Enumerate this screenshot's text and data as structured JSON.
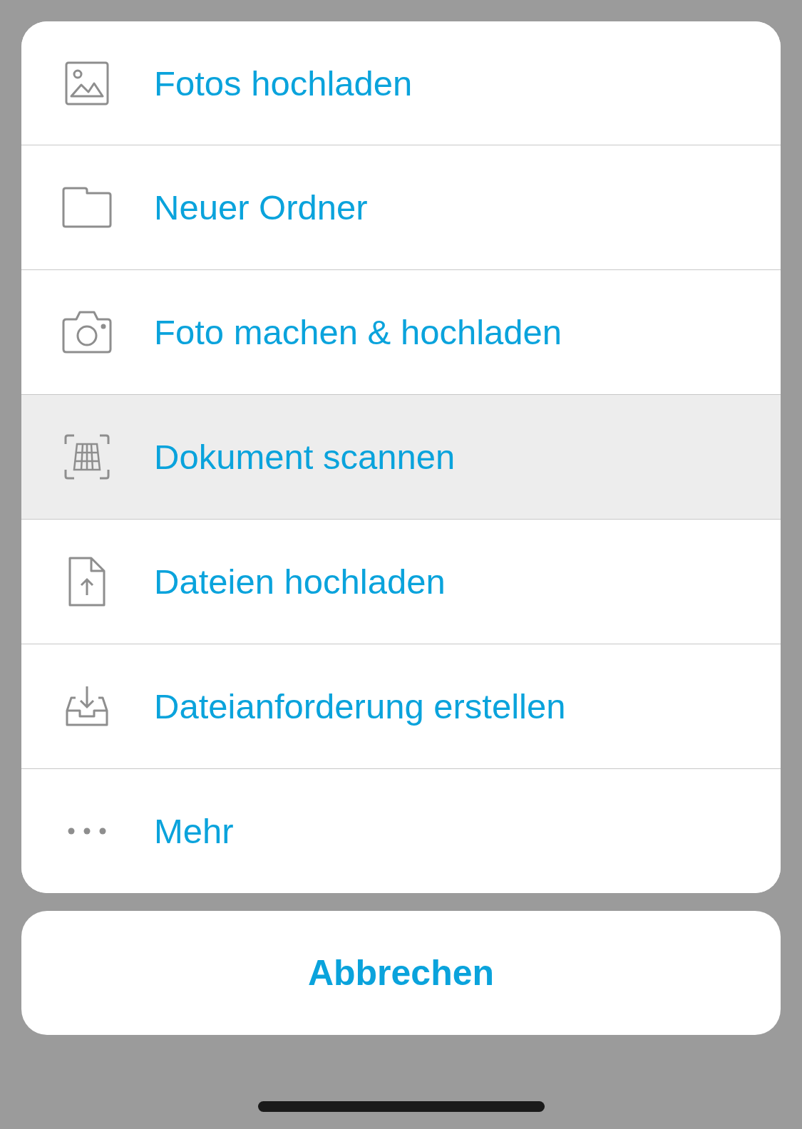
{
  "menu": {
    "items": [
      {
        "kind": "photo",
        "label": "Fotos hochladen",
        "highlighted": false
      },
      {
        "kind": "folder",
        "label": "Neuer Ordner",
        "highlighted": false
      },
      {
        "kind": "camera",
        "label": "Foto machen & hochladen",
        "highlighted": false
      },
      {
        "kind": "scan",
        "label": "Dokument scannen",
        "highlighted": true
      },
      {
        "kind": "upload",
        "label": "Dateien hochladen",
        "highlighted": false
      },
      {
        "kind": "inbox",
        "label": "Dateianforderung erstellen",
        "highlighted": false
      },
      {
        "kind": "more",
        "label": "Mehr",
        "highlighted": false
      }
    ]
  },
  "cancel_button": "Abbrechen"
}
